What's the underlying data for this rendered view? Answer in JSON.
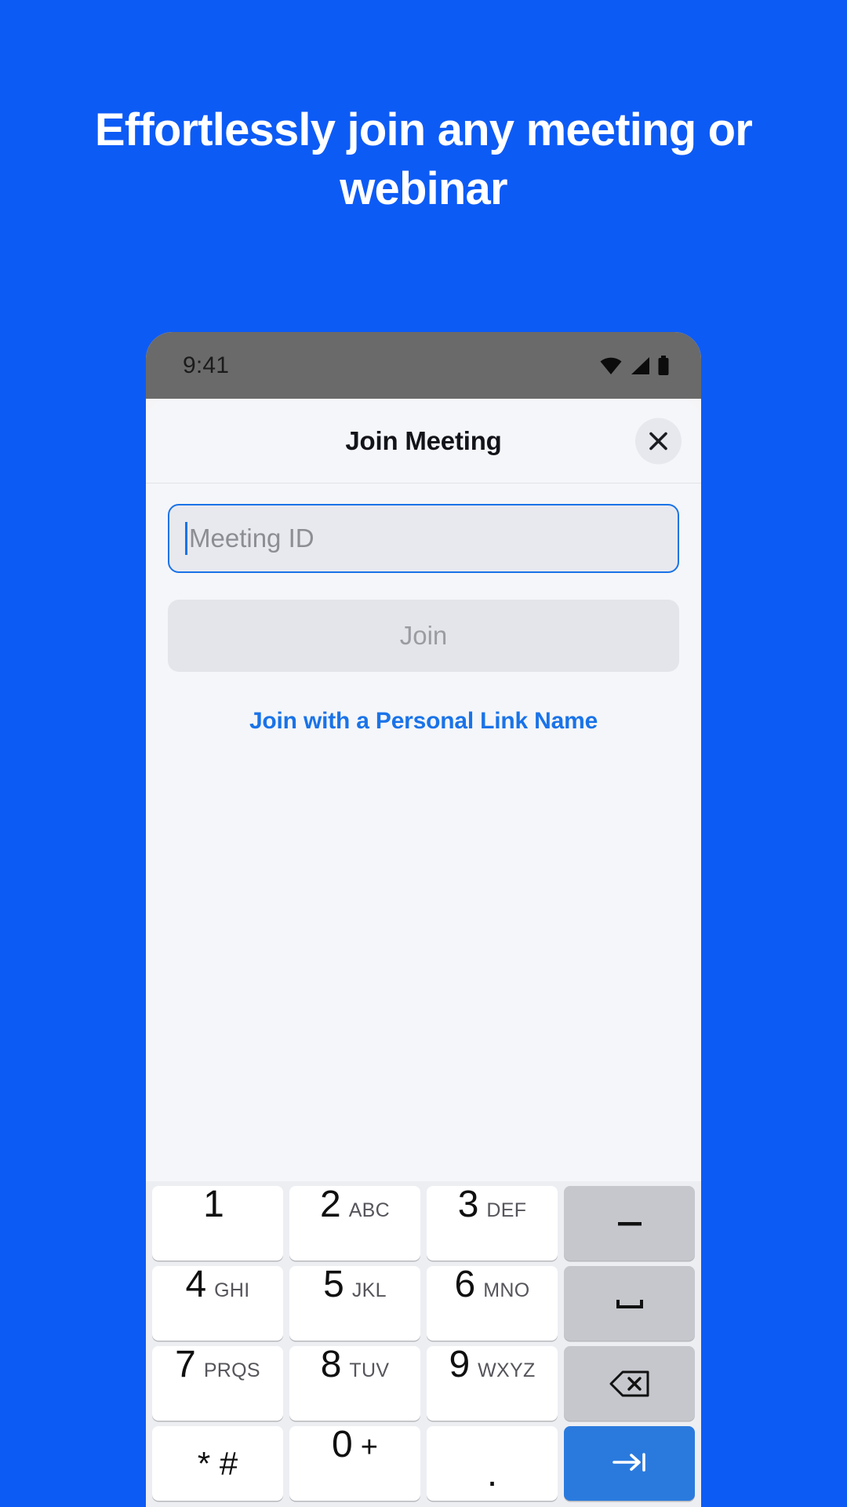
{
  "theme": {
    "background_blue": "#0d5bf5",
    "accent_blue": "#1a73e8",
    "sheet_background": "#f5f6f9",
    "keyboard_background": "#eceef2",
    "status_bar_gray": "#6a6a6a"
  },
  "headline": "Effortlessly join any meeting or webinar",
  "phone": {
    "status_bar": {
      "time": "9:41",
      "icons": [
        "wifi-icon",
        "cellular-signal-icon",
        "battery-icon"
      ]
    },
    "sheet": {
      "title": "Join Meeting",
      "close_label": "×",
      "meeting_id": {
        "value": "",
        "placeholder": "Meeting ID"
      },
      "join_button": "Join",
      "personal_link": "Join with a Personal Link Name"
    },
    "keyboard": {
      "rows": [
        [
          {
            "digit": "1",
            "letters": "",
            "type": "number"
          },
          {
            "digit": "2",
            "letters": "ABC",
            "type": "number"
          },
          {
            "digit": "3",
            "letters": "DEF",
            "type": "number"
          },
          {
            "digit": "",
            "letters": "",
            "type": "dash",
            "icon": "dash-icon"
          }
        ],
        [
          {
            "digit": "4",
            "letters": "GHI",
            "type": "number"
          },
          {
            "digit": "5",
            "letters": "JKL",
            "type": "number"
          },
          {
            "digit": "6",
            "letters": "MNO",
            "type": "number"
          },
          {
            "digit": "",
            "letters": "",
            "type": "space",
            "icon": "space-icon"
          }
        ],
        [
          {
            "digit": "7",
            "letters": "PRQS",
            "type": "number"
          },
          {
            "digit": "8",
            "letters": "TUV",
            "type": "number"
          },
          {
            "digit": "9",
            "letters": "WXYZ",
            "type": "number"
          },
          {
            "digit": "",
            "letters": "",
            "type": "backspace",
            "icon": "backspace-icon"
          }
        ],
        [
          {
            "digit": "* #",
            "letters": "",
            "type": "symbol"
          },
          {
            "digit": "0",
            "letters": "+",
            "type": "number"
          },
          {
            "digit": ".",
            "letters": "",
            "type": "period"
          },
          {
            "digit": "",
            "letters": "",
            "type": "next",
            "icon": "tab-next-icon"
          }
        ]
      ]
    }
  }
}
